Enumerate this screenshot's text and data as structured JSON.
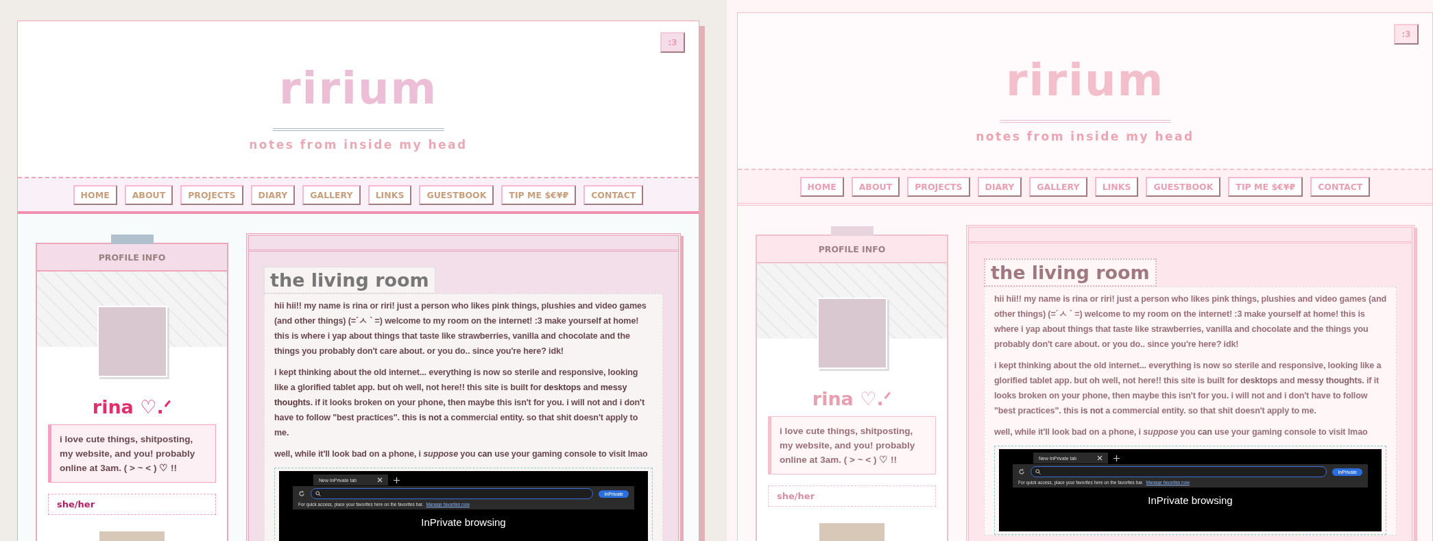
{
  "versions": [
    {
      "badge": ":3",
      "title": "ririum",
      "subtitle": "notes from inside my head",
      "nav": [
        "HOME",
        "ABOUT",
        "PROJECTS",
        "DIARY",
        "GALLERY",
        "LINKS",
        "GUESTBOOK",
        "TIP ME $€¥₽",
        "CONTACT"
      ],
      "profile": {
        "heading": "PROFILE INFO",
        "name": "rina ♡.ᐟ",
        "bio": "i love cute things, shitposting, my website, and you! probably online at 3am. ( > ~ < ) ♡ !!",
        "pronouns": "she/her"
      },
      "main": {
        "title": "the living room",
        "paragraphs": [
          "hii hii!! my name is rina or riri! just a person who likes pink things, plushies and video games (and other things) (=´ㅅ ` =) welcome to my room on the internet! :3 make yourself at home! this is where i yap about things that taste like strawberries, vanilla and chocolate and the things you probably don't care about. or you do.. since you're here? idk!",
          "i kept thinking about the old internet... everything is now so sterile and responsive, looking like a glorified tablet app. but oh well, not here!! this site is built for **desktops** and **messy thoughts**. if it looks broken on your phone, then maybe this isn't for you. i will not and i don't have to follow \"best practices\". this **is not** a commercial entity. so that shit doesn't apply to me.",
          "well, while it'll look bad on a phone, i *suppose* you **can** use your gaming console to visit lmao"
        ],
        "screenshot": {
          "tab_title": "New InPrivate tab",
          "favorites_hint": "For quick access, place your favorites here on the favorites bar.",
          "favorites_link": "Manage favorites now",
          "profile_badge": "InPrivate",
          "heading": "InPrivate browsing"
        }
      }
    },
    {
      "badge": ":3",
      "title": "ririum",
      "subtitle": "notes from inside my head",
      "nav": [
        "HOME",
        "ABOUT",
        "PROJECTS",
        "DIARY",
        "GALLERY",
        "LINKS",
        "GUESTBOOK",
        "TIP ME $€¥₽",
        "CONTACT"
      ],
      "profile": {
        "heading": "PROFILE INFO",
        "name": "rina ♡.ᐟ",
        "bio": "i love cute things, shitposting, my website, and you! probably online at 3am. ( > ~ < ) ♡ !!",
        "pronouns": "she/her"
      },
      "main": {
        "title": "the living room",
        "paragraphs": [
          "hii hii!! my name is rina or riri! just a person who likes pink things, plushies and video games (and other things) (=´ㅅ ` =) welcome to my room on the internet! :3 make yourself at home! this is where i yap about things that taste like strawberries, vanilla and chocolate and the things you probably don't care about. or you do.. since you're here? idk!",
          "i kept thinking about the old internet... everything is now so sterile and responsive, looking like a glorified tablet app. but oh well, not here!! this site is built for **desktops** and **messy thoughts**. if it looks broken on your phone, then maybe this isn't for you. i will not and i don't have to follow \"best practices\". this **is not** a commercial entity. so that shit doesn't apply to me.",
          "well, while it'll look bad on a phone, i *suppose* you **can** use your gaming console to visit lmao"
        ],
        "screenshot": {
          "tab_title": "New InPrivate tab",
          "favorites_hint": "For quick access, place your favorites here on the favorites bar.",
          "favorites_link": "Manage favorites now",
          "profile_badge": "InPrivate",
          "heading": "InPrivate browsing"
        }
      }
    }
  ]
}
